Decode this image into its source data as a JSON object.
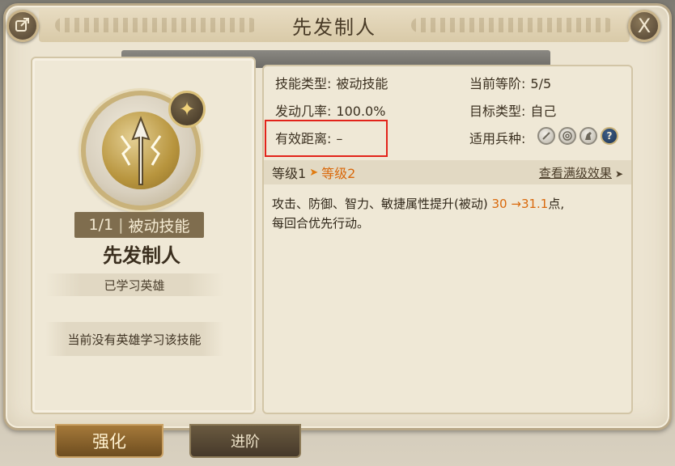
{
  "window": {
    "title": "先发制人",
    "close_label": "X"
  },
  "skill": {
    "level_count": "1/1",
    "separator": "|",
    "kind": "被动技能",
    "name": "先发制人",
    "learned_label": "已学习英雄",
    "no_hero_text": "当前没有英雄学习该技能"
  },
  "details": {
    "type_label": "技能类型:",
    "type_value": "被动技能",
    "rate_label": "发动几率:",
    "rate_value": "100.0%",
    "range_label": "有效距离:",
    "range_value": "–",
    "rank_label": "当前等阶:",
    "rank_value": "5/5",
    "target_label": "目标类型:",
    "target_value": "自己",
    "units_label": "适用兵种:",
    "unit_icons": [
      "sword-icon",
      "target-icon",
      "horse-icon",
      "question-icon"
    ]
  },
  "level_strip": {
    "level1": "等级1",
    "level2": "等级2",
    "view_max": "查看满级效果"
  },
  "description": {
    "text_prefix": "攻击、防御、智力、敏捷属性提升(被动)",
    "old_value": "30",
    "arrow": "→",
    "new_value": "31.1",
    "text_suffix": "点,",
    "line2": "每回合优先行动。"
  },
  "tabs": [
    {
      "label": "强化",
      "active": true
    },
    {
      "label": "进阶",
      "active": false
    }
  ],
  "colors": {
    "highlight_box": "#e2231a",
    "level2_orange": "#d9690c"
  }
}
